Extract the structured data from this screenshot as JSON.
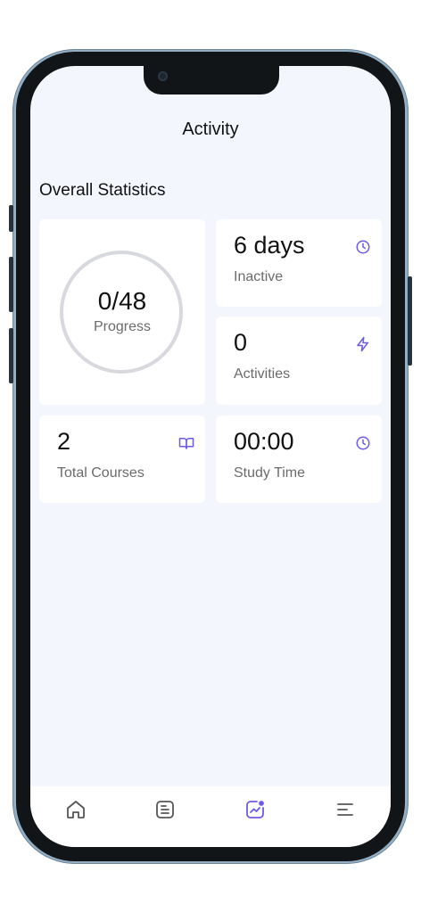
{
  "header": {
    "title": "Activity"
  },
  "section": {
    "title": "Overall Statistics"
  },
  "stats": {
    "progress": {
      "value": "0/48",
      "label": "Progress",
      "fraction": 0
    },
    "inactive": {
      "value": "6 days",
      "label": "Inactive",
      "icon": "clock-icon"
    },
    "activities": {
      "value": "0",
      "label": "Activities",
      "icon": "bolt-icon"
    },
    "courses": {
      "value": "2",
      "label": "Total Courses",
      "icon": "book-icon"
    },
    "study_time": {
      "value": "00:00",
      "label": "Study Time",
      "icon": "clock-icon"
    }
  },
  "bottom_nav": {
    "items": [
      {
        "icon": "home-icon",
        "active": false
      },
      {
        "icon": "document-icon",
        "active": false
      },
      {
        "icon": "chart-icon",
        "active": true
      },
      {
        "icon": "menu-icon",
        "active": false
      }
    ]
  },
  "colors": {
    "accent": "#6b5ce7",
    "background": "#f3f6fd",
    "ring_track": "#d8d9df",
    "nav_inactive": "#555555"
  }
}
